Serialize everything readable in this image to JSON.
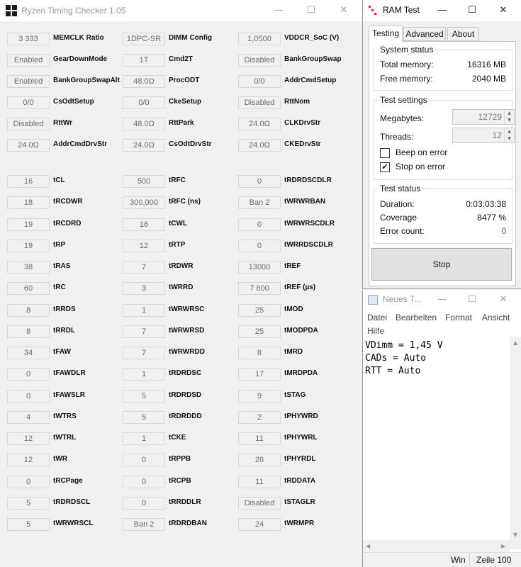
{
  "rtc": {
    "title": "Ryzen Timing Checker 1.05",
    "win_min": "—",
    "win_max": "☐",
    "win_close": "✕",
    "config_rows": [
      [
        {
          "value": "3 333",
          "label": "MEMCLK Ratio"
        },
        {
          "value": "1DPC-SR",
          "label": "DIMM Config"
        },
        {
          "value": "1,0500",
          "label": "VDDCR_SoC (V)"
        }
      ],
      [
        {
          "value": "Enabled",
          "label": "GearDownMode"
        },
        {
          "value": "1T",
          "label": "Cmd2T"
        },
        {
          "value": "Disabled",
          "label": "BankGroupSwap"
        }
      ],
      [
        {
          "value": "Enabled",
          "label": "BankGroupSwapAlt"
        },
        {
          "value": "48.0Ω",
          "label": "ProcODT"
        },
        {
          "value": "0/0",
          "label": "AddrCmdSetup"
        }
      ],
      [
        {
          "value": "0/0",
          "label": "CsOdtSetup"
        },
        {
          "value": "0/0",
          "label": "CkeSetup"
        },
        {
          "value": "Disabled",
          "label": "RttNom"
        }
      ],
      [
        {
          "value": "Disabled",
          "label": "RttWr"
        },
        {
          "value": "48.0Ω",
          "label": "RttPark"
        },
        {
          "value": "24.0Ω",
          "label": "CLKDrvStr"
        }
      ],
      [
        {
          "value": "24.0Ω",
          "label": "AddrCmdDrvStr"
        },
        {
          "value": "24.0Ω",
          "label": "CsOdtDrvStr"
        },
        {
          "value": "24.0Ω",
          "label": "CKEDrvStr"
        }
      ]
    ],
    "timing_rows": [
      [
        {
          "value": "16",
          "label": "tCL"
        },
        {
          "value": "500",
          "label": "tRFC"
        },
        {
          "value": "0",
          "label": "tRDRDSCDLR"
        }
      ],
      [
        {
          "value": "18",
          "label": "tRCDWR"
        },
        {
          "value": "300,000",
          "label": "tRFC (ns)"
        },
        {
          "value": "Ban 2",
          "label": "tWRWRBAN"
        }
      ],
      [
        {
          "value": "19",
          "label": "tRCDRD"
        },
        {
          "value": "16",
          "label": "tCWL"
        },
        {
          "value": "0",
          "label": "tWRWRSCDLR"
        }
      ],
      [
        {
          "value": "19",
          "label": "tRP"
        },
        {
          "value": "12",
          "label": "tRTP"
        },
        {
          "value": "0",
          "label": "tWRRDSCDLR"
        }
      ],
      [
        {
          "value": "38",
          "label": "tRAS"
        },
        {
          "value": "7",
          "label": "tRDWR"
        },
        {
          "value": "13000",
          "label": "tREF"
        }
      ],
      [
        {
          "value": "60",
          "label": "tRC"
        },
        {
          "value": "3",
          "label": "tWRRD"
        },
        {
          "value": "7 800",
          "label": "tREF (µs)"
        }
      ],
      [
        {
          "value": "8",
          "label": "tRRDS"
        },
        {
          "value": "1",
          "label": "tWRWRSC"
        },
        {
          "value": "25",
          "label": "tMOD"
        }
      ],
      [
        {
          "value": "8",
          "label": "tRRDL"
        },
        {
          "value": "7",
          "label": "tWRWRSD"
        },
        {
          "value": "25",
          "label": "tMODPDA"
        }
      ],
      [
        {
          "value": "34",
          "label": "tFAW"
        },
        {
          "value": "7",
          "label": "tWRWRDD"
        },
        {
          "value": "8",
          "label": "tMRD"
        }
      ],
      [
        {
          "value": "0",
          "label": "tFAWDLR"
        },
        {
          "value": "1",
          "label": "tRDRDSC"
        },
        {
          "value": "17",
          "label": "tMRDPDA"
        }
      ],
      [
        {
          "value": "0",
          "label": "tFAWSLR"
        },
        {
          "value": "5",
          "label": "tRDRDSD"
        },
        {
          "value": "9",
          "label": "tSTAG"
        }
      ],
      [
        {
          "value": "4",
          "label": "tWTRS"
        },
        {
          "value": "5",
          "label": "tRDRDDD"
        },
        {
          "value": "2",
          "label": "tPHYWRD"
        }
      ],
      [
        {
          "value": "12",
          "label": "tWTRL"
        },
        {
          "value": "1",
          "label": "tCKE"
        },
        {
          "value": "11",
          "label": "tPHYWRL"
        }
      ],
      [
        {
          "value": "12",
          "label": "tWR"
        },
        {
          "value": "0",
          "label": "tRPPB"
        },
        {
          "value": "26",
          "label": "tPHYRDL"
        }
      ],
      [
        {
          "value": "0",
          "label": "tRCPage"
        },
        {
          "value": "0",
          "label": "tRCPB"
        },
        {
          "value": "11",
          "label": "tRDDATA"
        }
      ],
      [
        {
          "value": "5",
          "label": "tRDRDSCL"
        },
        {
          "value": "0",
          "label": "tRRDDLR"
        },
        {
          "value": "Disabled",
          "label": "tSTAGLR"
        }
      ],
      [
        {
          "value": "5",
          "label": "tWRWRSCL"
        },
        {
          "value": "Ban 2",
          "label": "tRDRDBAN"
        },
        {
          "value": "24",
          "label": "tWRMPR"
        }
      ]
    ]
  },
  "ramtest": {
    "title": "RAM Test",
    "win_min": "—",
    "win_max": "☐",
    "win_close": "✕",
    "tabs": [
      "Testing",
      "Advanced",
      "About"
    ],
    "active_tab": "Testing",
    "system_status": {
      "title": "System status",
      "total_memory_label": "Total memory:",
      "total_memory_value": "16316 MB",
      "free_memory_label": "Free memory:",
      "free_memory_value": "2040 MB"
    },
    "test_settings": {
      "title": "Test settings",
      "megabytes_label": "Megabytes:",
      "megabytes_value": "12729",
      "threads_label": "Threads:",
      "threads_value": "12",
      "beep_label": "Beep on error",
      "beep_checked": false,
      "stop_label": "Stop on error",
      "stop_checked": true,
      "check_mark": "✔",
      "spin_up": "▲",
      "spin_down": "▼"
    },
    "test_status": {
      "title": "Test status",
      "duration_label": "Duration:",
      "duration_value": "0:03:03:38",
      "coverage_label": "Coverage",
      "coverage_value": "8477 %",
      "error_label": "Error count:",
      "error_value": "0",
      "error_color": "#2e8b2e"
    },
    "stop_button": "Stop"
  },
  "notepad": {
    "title": "Neues T...",
    "win_min": "—",
    "win_max": "☐",
    "win_close": "✕",
    "menu": [
      "Datei",
      "Bearbeiten",
      "Format",
      "Ansicht",
      "Hilfe"
    ],
    "lines": [
      "VDimm = 1,45 V",
      "CADs = Auto",
      "RTT = Auto"
    ],
    "status_left": "Win",
    "status_right": "Zeile 100",
    "arrow_up": "▲",
    "arrow_down": "▼",
    "arrow_left": "◀",
    "arrow_right": "▶"
  }
}
